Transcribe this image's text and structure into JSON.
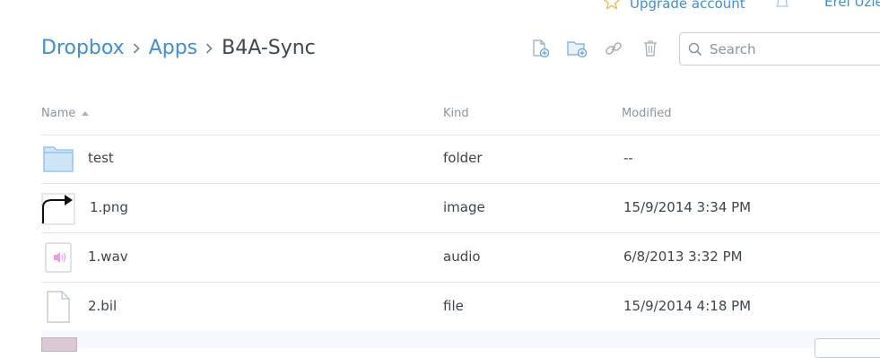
{
  "topbar": {
    "upgrade_label": "Upgrade account",
    "username": "Erel Uziel",
    "icons": [
      "star-icon",
      "bell-icon"
    ]
  },
  "breadcrumb": {
    "items": [
      "Dropbox",
      "Apps"
    ],
    "current": "B4A-Sync"
  },
  "toolbar": {
    "icons": [
      "new-file-icon",
      "new-folder-icon",
      "share-link-icon",
      "delete-icon"
    ]
  },
  "search": {
    "placeholder": "Search",
    "value": ""
  },
  "table": {
    "columns": {
      "name": "Name",
      "kind": "Kind",
      "modified": "Modified"
    },
    "sort": {
      "column": "Name",
      "direction": "ascending"
    },
    "rows": [
      {
        "name": "test",
        "kind": "folder",
        "modified": "--",
        "icon": "folder-icon"
      },
      {
        "name": "1.png",
        "kind": "image",
        "modified": "15/9/2014 3:34 PM",
        "icon": "image-thumbnail-icon"
      },
      {
        "name": "1.wav",
        "kind": "audio",
        "modified": "6/8/2013 3:32 PM",
        "icon": "audio-file-icon"
      },
      {
        "name": "2.bil",
        "kind": "file",
        "modified": "15/9/2014 4:18 PM",
        "icon": "file-icon"
      }
    ]
  },
  "colors": {
    "link": "#3d8fd8",
    "text": "#3d464d",
    "muted": "#8a969f",
    "folder": "#a9d1f0",
    "audio": "#e47be0",
    "row_highlight": "#f5f9fd"
  }
}
